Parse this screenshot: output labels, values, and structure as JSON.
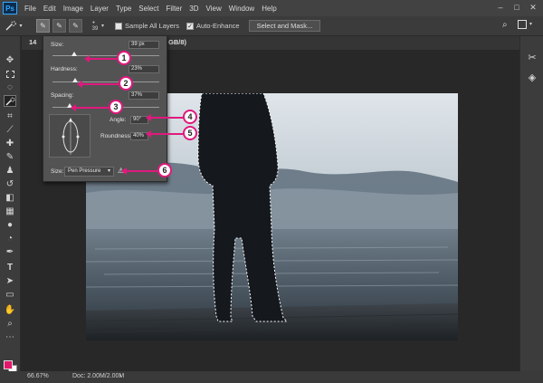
{
  "app": {
    "logo": "Ps"
  },
  "menu": [
    "File",
    "Edit",
    "Image",
    "Layer",
    "Type",
    "Select",
    "Filter",
    "3D",
    "View",
    "Window",
    "Help"
  ],
  "window_controls": [
    "–",
    "□",
    "✕"
  ],
  "options_bar": {
    "brush_size": "39",
    "sample_all_layers": {
      "label": "Sample All Layers",
      "checked": false
    },
    "auto_enhance": {
      "label": "Auto-Enhance",
      "checked": true
    },
    "select_and_mask": "Select and Mask..."
  },
  "document_tab": {
    "left": "14",
    "right": "GB/8)"
  },
  "brush_panel": {
    "size_label": "Size:",
    "size_value": "39 px",
    "size_level": 0.2,
    "hardness_label": "Hardness:",
    "hardness_value": "23%",
    "spacing_label": "Spacing:",
    "spacing_value": "37%",
    "angle_label": "Angle:",
    "angle_value": "90°",
    "roundness_label": "Roundness:",
    "roundness_value": "40%",
    "size_control_label": "Size:",
    "size_control_value": "Pen Pressure",
    "warning_icon": "⚠"
  },
  "callouts": [
    "1",
    "2",
    "3",
    "4",
    "5",
    "6"
  ],
  "status_bar": {
    "zoom": "66.67%",
    "doc": "Doc: 2.00M/2.00M"
  },
  "colors": {
    "foreground": "#e3186d",
    "background": "#ffffff",
    "callout_accent": "#e0197d"
  }
}
